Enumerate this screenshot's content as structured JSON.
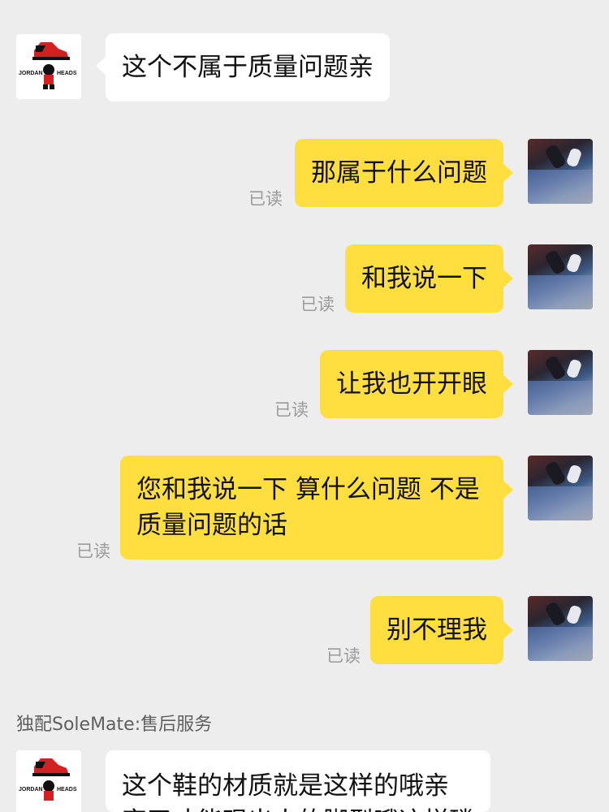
{
  "chat": {
    "shop_logo": {
      "top_text": "JORDAN",
      "side_text": "HEADS"
    },
    "messages": [
      {
        "text": "这个不属于质量问题亲"
      },
      {
        "text": "那属于什么问题",
        "status": "已读"
      },
      {
        "text": "和我说一下",
        "status": "已读"
      },
      {
        "text": "让我也开开眼",
        "status": "已读"
      },
      {
        "text": "您和我说一下 算什么问题 不是质量问题的话",
        "status": "已读"
      },
      {
        "text": "别不理我",
        "status": "已读"
      }
    ],
    "sender_label": "独配SoleMate:售后服务",
    "last_message": {
      "line1": "这个鞋的材质就是这样的哦亲",
      "line2": "穿了才能现出人的脚型哦这样磷"
    }
  },
  "colors": {
    "background": "#ededed",
    "incoming_bubble": "#ffffff",
    "outgoing_bubble": "#ffdf3f",
    "read_status": "#9b9b9b"
  }
}
